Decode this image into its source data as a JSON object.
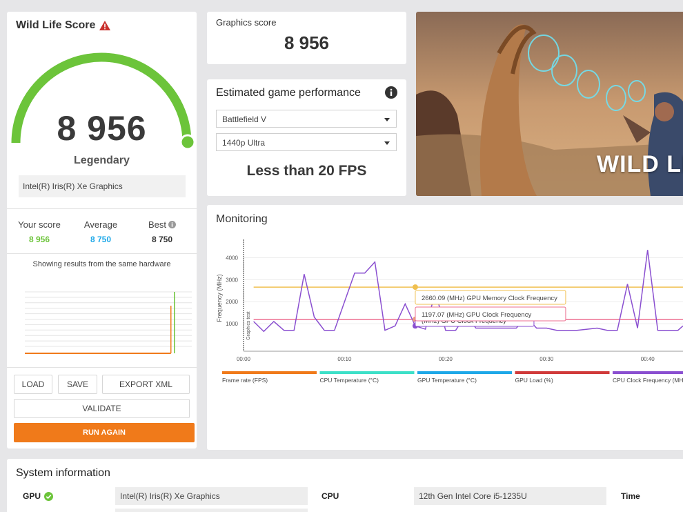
{
  "score_card": {
    "title": "Wild Life Score",
    "score": "8 956",
    "rank": "Legendary",
    "gpu": "Intel(R) Iris(R) Xe Graphics",
    "gauge_fill_fraction": 1.0,
    "compare": {
      "your_label": "Your score",
      "your_value": "8 956",
      "avg_label": "Average",
      "avg_value": "8 750",
      "best_label": "Best",
      "best_value": "8 750"
    },
    "hardware_note": "Showing results from the same hardware",
    "buttons": {
      "load": "LOAD",
      "save": "SAVE",
      "export": "EXPORT XML",
      "validate": "VALIDATE",
      "run_again": "RUN AGAIN"
    }
  },
  "graphics_score": {
    "label": "Graphics score",
    "value": "8 956"
  },
  "game_perf": {
    "title": "Estimated game performance",
    "game": "Battlefield V",
    "preset": "1440p Ultra",
    "result": "Less than 20 FPS"
  },
  "hero": {
    "title": "WILD LIFE"
  },
  "monitoring": {
    "title": "Monitoring",
    "tooltips": {
      "memory": "2660.09 (MHz) GPU Memory Clock Frequency",
      "gpu": "1197.07 (MHz) GPU Clock Frequency",
      "hidden": "(MHz) GPU Clock Frequency"
    },
    "legend": [
      {
        "label": "Frame rate (FPS)",
        "color": "#f07a1a"
      },
      {
        "label": "CPU Temperature (°C)",
        "color": "#3de0c8"
      },
      {
        "label": "GPU Temperature (°C)",
        "color": "#1ea8e8"
      },
      {
        "label": "GPU Load (%)",
        "color": "#d03a3a"
      },
      {
        "label": "CPU Clock Frequency (MHz)",
        "color": "#8a4fd0"
      }
    ]
  },
  "system_info": {
    "title": "System information",
    "gpu_label": "GPU",
    "gpu_value": "Intel(R) Iris(R) Xe Graphics",
    "cpu_label": "CPU",
    "cpu_value": "12th Gen Intel Core i5-1235U",
    "time_label": "Time"
  },
  "colors": {
    "accent_orange": "#f07a1a",
    "gauge_green": "#6cc43a",
    "avg_blue": "#1ea8e8",
    "warning_red": "#c9302c"
  },
  "chart_data": [
    {
      "type": "bar",
      "description_note": "score distribution histogram",
      "x_ticks": [
        "0",
        "2500",
        "5000",
        "7500"
      ],
      "xlim": [
        0,
        10000
      ],
      "series": [
        {
          "color": "#f07a1a",
          "x": [
            0,
            8750
          ],
          "values": [
            0,
            0
          ]
        },
        {
          "color": "#6cc43a",
          "x": [
            8956
          ],
          "values": [
            1
          ]
        }
      ],
      "marker_lines": [
        8956,
        8750
      ]
    },
    {
      "type": "line",
      "ylabel": "Frequency (MHz)",
      "y_ticks": [
        1000,
        2000,
        3000,
        4000
      ],
      "ylim": [
        0,
        4700
      ],
      "x_ticks": [
        "00:00",
        "00:10",
        "00:20",
        "00:30",
        "00:40"
      ],
      "xlim_minutes": [
        0,
        43.5
      ],
      "phase_label": "Graphics test",
      "series": [
        {
          "name": "CPU Clock Frequency (MHz)",
          "color": "#8a4fd0",
          "t": [
            1.0,
            2.0,
            3.0,
            4.0,
            5.0,
            6.0,
            7.0,
            8.0,
            9.0,
            10.0,
            11.0,
            12.0,
            13.0,
            14.0,
            15.0,
            16.0,
            17.0,
            18.0,
            19.0,
            20.0,
            21.0,
            22.0,
            23.0,
            24.0,
            25.0,
            26.0,
            27.0,
            28.0,
            29.0,
            30.0,
            31.0,
            32.0,
            33.0,
            34.0,
            35.0,
            36.0,
            37.0,
            38.0,
            39.0,
            40.0,
            41.0,
            42.0,
            43.0,
            43.5
          ],
          "values": [
            1100,
            650,
            1100,
            700,
            700,
            3250,
            1300,
            700,
            700,
            2000,
            3300,
            3300,
            3800,
            700,
            900,
            1900,
            900,
            750,
            2450,
            700,
            700,
            1400,
            800,
            800,
            800,
            800,
            800,
            1300,
            800,
            800,
            700,
            700,
            700,
            750,
            800,
            700,
            700,
            2800,
            800,
            4350,
            700,
            700,
            700,
            900
          ]
        },
        {
          "name": "GPU Memory Clock Frequency",
          "color": "#f0c050",
          "t": [
            1.0,
            43.5
          ],
          "values": [
            2660,
            2660
          ]
        },
        {
          "name": "GPU Clock Frequency",
          "color": "#ec6d8f",
          "t": [
            1.0,
            43.5
          ],
          "values": [
            1197,
            1197
          ]
        }
      ]
    }
  ]
}
